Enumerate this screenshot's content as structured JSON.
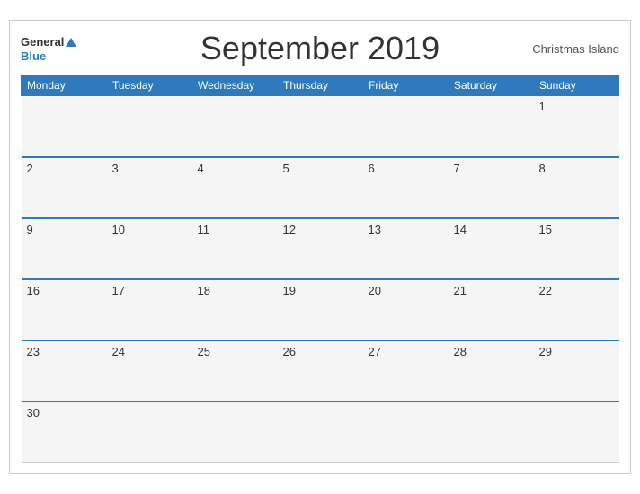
{
  "header": {
    "logo_general": "General",
    "logo_blue": "Blue",
    "title": "September 2019",
    "region": "Christmas Island"
  },
  "days_of_week": [
    "Monday",
    "Tuesday",
    "Wednesday",
    "Thursday",
    "Friday",
    "Saturday",
    "Sunday"
  ],
  "weeks": [
    [
      "",
      "",
      "",
      "",
      "",
      "",
      "1"
    ],
    [
      "2",
      "3",
      "4",
      "5",
      "6",
      "7",
      "8"
    ],
    [
      "9",
      "10",
      "11",
      "12",
      "13",
      "14",
      "15"
    ],
    [
      "16",
      "17",
      "18",
      "19",
      "20",
      "21",
      "22"
    ],
    [
      "23",
      "24",
      "25",
      "26",
      "27",
      "28",
      "29"
    ],
    [
      "30",
      "",
      "",
      "",
      "",
      "",
      ""
    ]
  ]
}
